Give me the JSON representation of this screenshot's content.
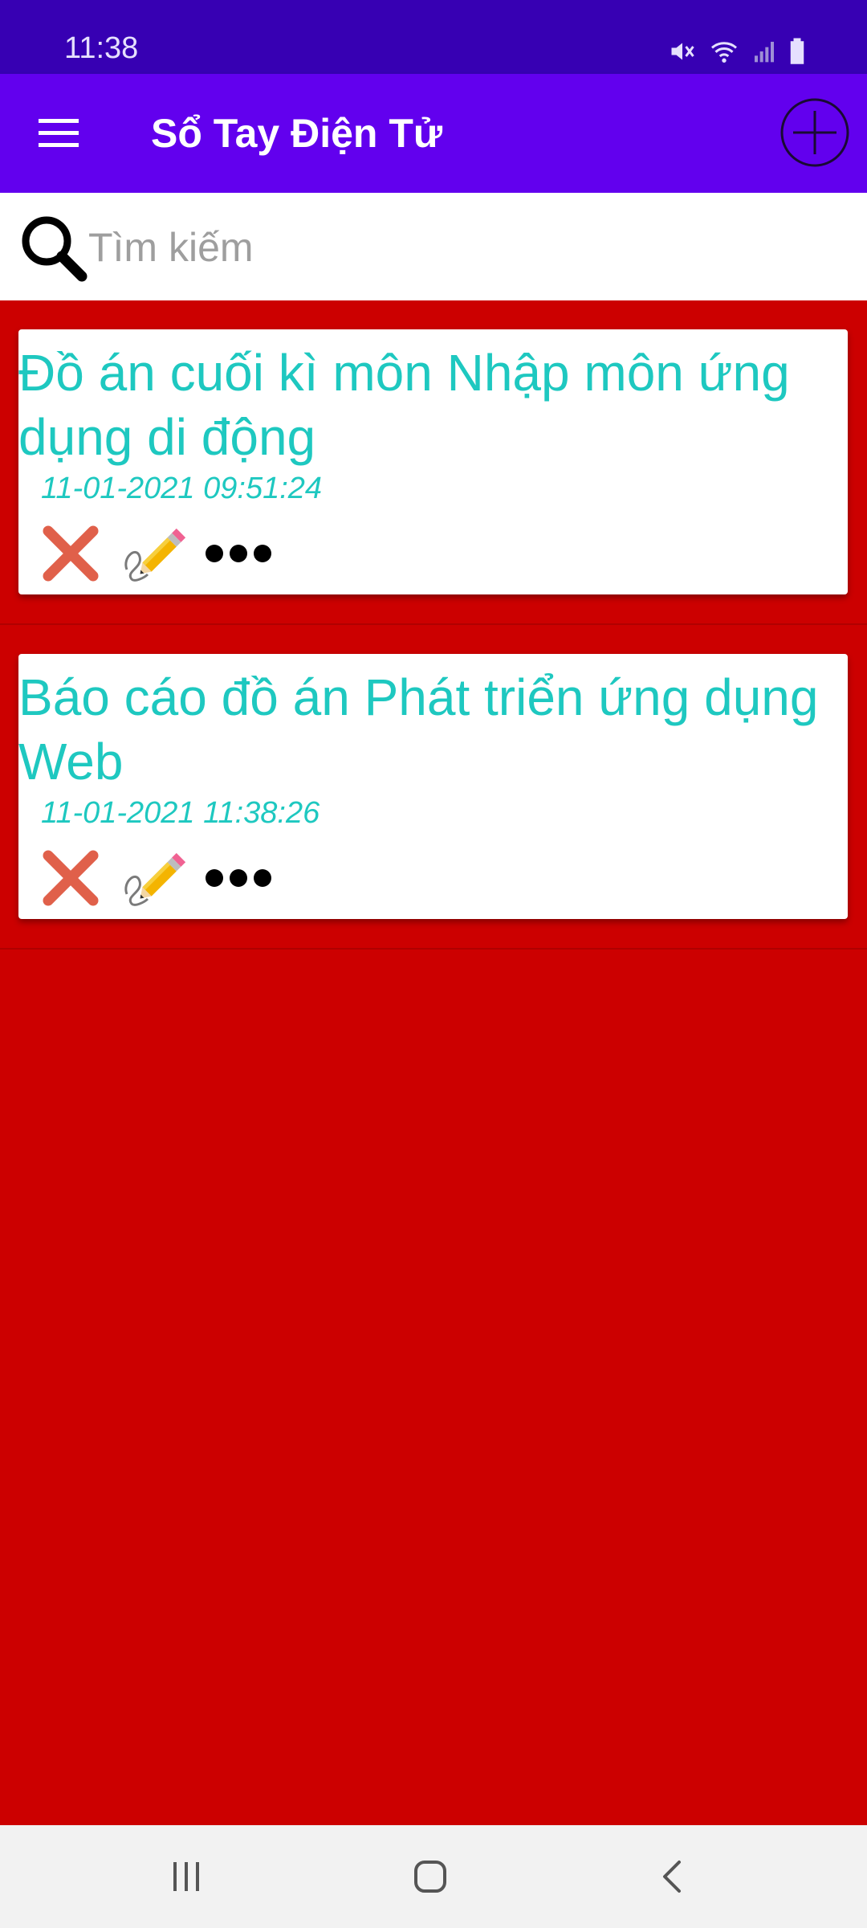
{
  "status_bar": {
    "time": "11:38",
    "icons": [
      "mute-icon",
      "wifi-icon",
      "signal-icon",
      "battery-icon"
    ]
  },
  "app_bar": {
    "title": "Sổ Tay Điện Tử",
    "menu_icon": "hamburger-menu-icon",
    "add_icon": "add-circle-icon"
  },
  "search": {
    "placeholder": "Tìm kiếm",
    "value": "",
    "icon": "search-icon"
  },
  "notes": [
    {
      "title": "Đồ án cuối kì môn Nhập môn ứng dụng di động",
      "date": "11-01-2021 09:51:24",
      "actions": [
        "delete-icon",
        "edit-icon",
        "more-icon"
      ]
    },
    {
      "title": "Báo cáo đồ án Phát triển ứng dụng Web",
      "date": "11-01-2021 11:38:26",
      "actions": [
        "delete-icon",
        "edit-icon",
        "more-icon"
      ]
    }
  ],
  "nav_bar": {
    "buttons": [
      "recent-apps-icon",
      "home-icon",
      "back-icon"
    ]
  },
  "colors": {
    "status_bar": "#3700b3",
    "app_bar": "#6200ee",
    "background": "#cc0000",
    "note_text": "#1ec8c0",
    "card": "#ffffff"
  }
}
